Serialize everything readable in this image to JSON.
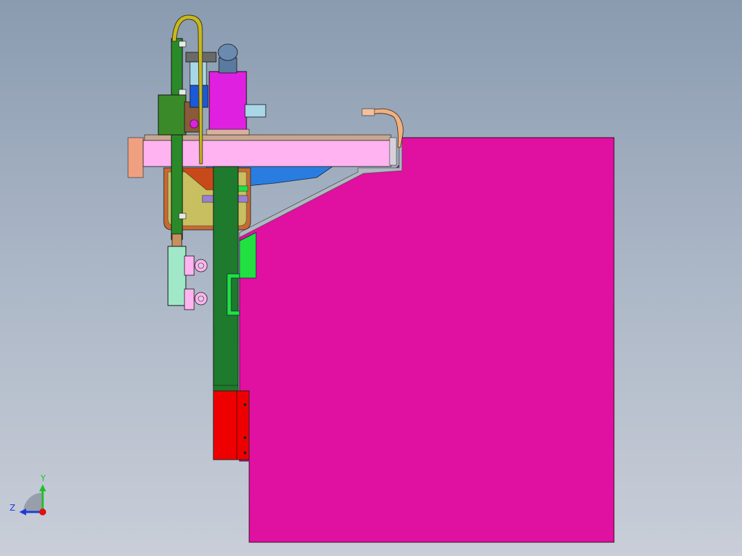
{
  "viewport": {
    "background_top": "#8a9bb0",
    "background_bottom": "#c9ced8"
  },
  "triad": {
    "y_label": "Y",
    "z_label": "Z",
    "y_color": "#1fbf2a",
    "z_color": "#1a3ad8",
    "x_color": "#e01010"
  },
  "model_colors": {
    "frame": "#e010a0",
    "column": "#1e7a2c",
    "rail": "#2a8a2a",
    "beam": "#ffb3f0",
    "red_block": "#ee0000",
    "motor": "#e020e0",
    "cable": "#c8b820",
    "hopper_blue": "#2a7de0",
    "hopper_body": "#c8c060",
    "gripper": "#a0e8c8",
    "bracket": "#22e040",
    "stopper": "#f0a080"
  }
}
